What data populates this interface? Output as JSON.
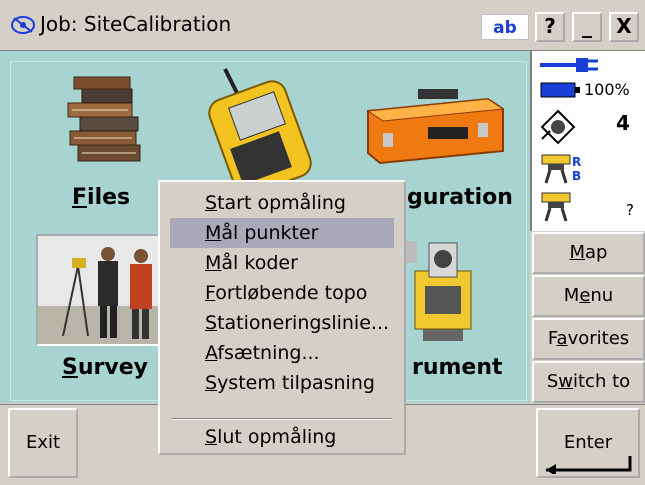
{
  "titlebar": {
    "title": "Job: SiteCalibration",
    "ime": "ab",
    "help_label": "?",
    "minimize_label": "_",
    "close_label": "X"
  },
  "tiles": {
    "files": {
      "pre": "",
      "accel": "F",
      "post": "iles"
    },
    "configuration": {
      "text": "guration"
    },
    "survey": {
      "pre": "",
      "accel": "S",
      "post": "urvey"
    },
    "instrument": {
      "text": "rument"
    }
  },
  "status": {
    "battery_percent": "100%",
    "satellites": "4",
    "receiver_r": "R",
    "receiver_b": "B",
    "unknown": "?"
  },
  "side_buttons": {
    "map": {
      "accel": "M",
      "post": "ap"
    },
    "menu": {
      "pre": "M",
      "accel": "e",
      "post": "nu"
    },
    "favorites": {
      "pre": "F",
      "accel": "a",
      "post": "vorites"
    },
    "switch_to": {
      "pre": "S",
      "accel": "w",
      "post": "itch to"
    }
  },
  "bottom": {
    "exit_label": "Exit",
    "enter_label": "Enter"
  },
  "context_menu": {
    "items": [
      {
        "accel": "S",
        "post": "tart opmåling"
      },
      {
        "accel": "M",
        "post": "ål punkter"
      },
      {
        "accel": "M",
        "post": "ål koder"
      },
      {
        "accel": "F",
        "post": "ortløbende topo"
      },
      {
        "accel": "S",
        "post": "tationeringslinie..."
      },
      {
        "accel": "A",
        "post": "fsætning..."
      },
      {
        "accel": "S",
        "post": "ystem tilpasning"
      },
      {
        "accel": "S",
        "post": "lut opmåling"
      }
    ]
  }
}
